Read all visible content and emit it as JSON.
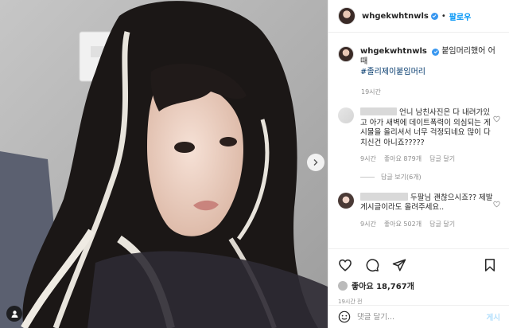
{
  "header": {
    "username": "whgekwhtnwls",
    "follow_label": "팔로우"
  },
  "caption": {
    "username": "whgekwhtnwls",
    "text": "붙임머리했어 어때",
    "hashtag": "#졸리제이붙임머리",
    "time": "19시간"
  },
  "comments": [
    {
      "text": "언니 남친사진은 다 내려가있고 아가 새벽에 데이트폭력이 의심되는 게시물을 올리셔서 너무 걱정되네요 많이 다치신건 아니죠?????",
      "time": "9시간",
      "likes": "좋아요 879개",
      "reply": "답글 달기",
      "view_replies": "답글 보기(6개)"
    },
    {
      "text": "두팔님 괜찮으시죠?? 제발 게시글이라도 올려주세요..",
      "time": "9시간",
      "likes": "좋아요 502개",
      "reply": "답글 달기"
    }
  ],
  "actions": {
    "like_icon": "heart-icon",
    "comment_icon": "comment-icon",
    "share_icon": "share-icon",
    "save_icon": "bookmark-icon",
    "likes_count": "좋아요 18,767개",
    "post_time": "19시간 전"
  },
  "add_comment": {
    "emoji_icon": "smiley-icon",
    "placeholder": "댓글 달기...",
    "post_label": "게시"
  },
  "colors": {
    "accent": "#0095f6",
    "verified": "#3897f0",
    "muted": "#8e8e8e"
  }
}
